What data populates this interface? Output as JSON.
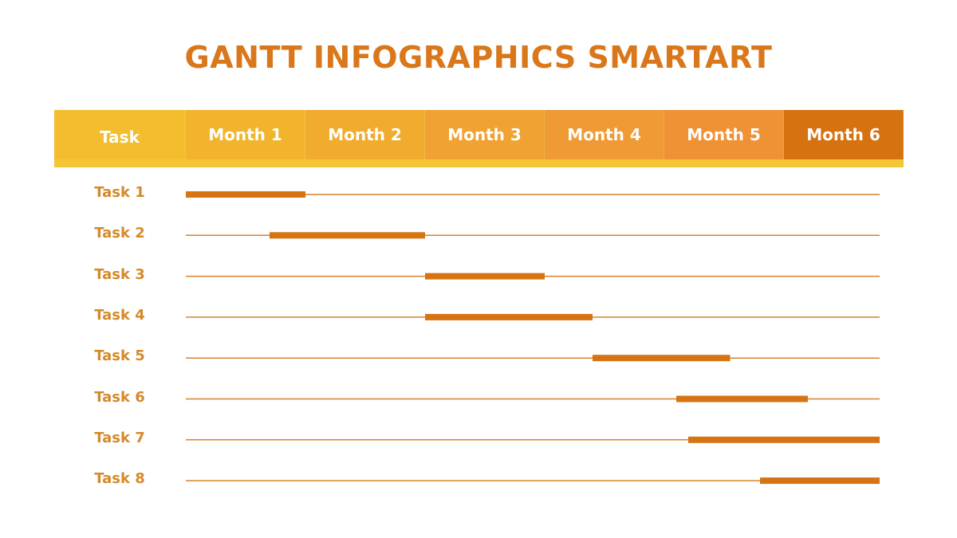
{
  "title": "GANTT INFOGRAPHICS SMARTART",
  "colors": {
    "title": "#d9771a",
    "bar": "#d67312",
    "line": "#d9822b",
    "label": "#d48a2a",
    "header_task": "#f4bd30",
    "header_months": [
      "#f2b42c",
      "#f1ab2e",
      "#f0a232",
      "#ef9a34",
      "#ee9235",
      "#d6720f"
    ]
  },
  "chart_data": {
    "type": "gantt",
    "title": "GANTT INFOGRAPHICS SMARTART",
    "header_label": "Task",
    "categories": [
      "Month 1",
      "Month 2",
      "Month 3",
      "Month 4",
      "Month 5",
      "Month 6"
    ],
    "xlim_months": [
      0,
      6
    ],
    "tasks": [
      {
        "name": "Task 1",
        "start": 0.0,
        "end": 1.0
      },
      {
        "name": "Task 2",
        "start": 0.7,
        "end": 2.0
      },
      {
        "name": "Task 3",
        "start": 2.0,
        "end": 3.0
      },
      {
        "name": "Task 4",
        "start": 2.0,
        "end": 3.4
      },
      {
        "name": "Task 5",
        "start": 3.4,
        "end": 4.55
      },
      {
        "name": "Task 6",
        "start": 4.1,
        "end": 5.2
      },
      {
        "name": "Task 7",
        "start": 4.2,
        "end": 5.8
      },
      {
        "name": "Task 8",
        "start": 4.8,
        "end": 5.8
      }
    ],
    "timeline_end": 5.8
  }
}
